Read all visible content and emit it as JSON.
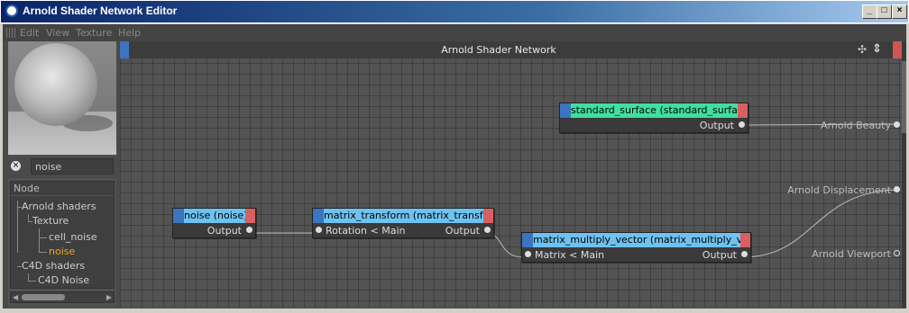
{
  "window": {
    "title": "Arnold Shader Network Editor",
    "controls": {
      "minimize": "_",
      "maximize": "□",
      "close": "×"
    }
  },
  "menu": [
    "Edit",
    "View",
    "Texture",
    "Help"
  ],
  "search": {
    "value": "noise",
    "clear_icon": "×"
  },
  "tree": {
    "header": "Node",
    "items": [
      "Arnold shaders",
      "Texture",
      "cell_noise",
      "noise",
      "C4D shaders",
      "C4D Noise"
    ],
    "selected": "noise"
  },
  "canvas": {
    "title": "Arnold Shader Network",
    "icons": {
      "move": "✣",
      "updown": "⇕"
    }
  },
  "nodes": {
    "standard": {
      "title": "standard_surface (standard_surface)",
      "output": "Output",
      "color": "#3ee0a0"
    },
    "noise": {
      "title": "noise (noise)",
      "output": "Output",
      "color": "#6fc2f0"
    },
    "matrix_transform": {
      "title": "matrix_transform (matrix_transform)",
      "input": "Rotation < Main",
      "output": "Output",
      "color": "#6fc2f0"
    },
    "matrix_multiply": {
      "title": "matrix_multiply_vector (matrix_multiply_vector)",
      "input": "Matrix < Main",
      "output": "Output",
      "color": "#6fc2f0"
    }
  },
  "sinks": [
    "Arnold Beauty",
    "Arnold Displacement",
    "Arnold Viewport"
  ],
  "colors": {
    "port_blue": "#3b74c0",
    "port_red": "#d86060",
    "selected_text": "#f0a020"
  }
}
